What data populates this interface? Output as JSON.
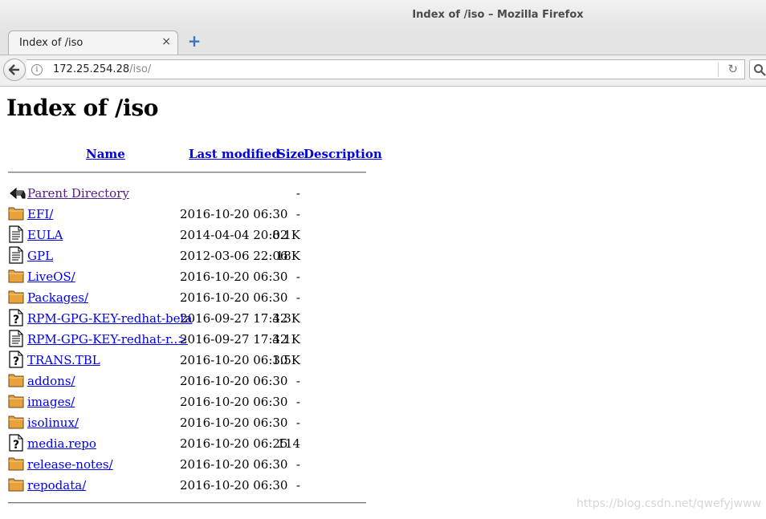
{
  "window": {
    "title": "Index of /iso – Mozilla Firefox"
  },
  "tab": {
    "title": "Index of /iso",
    "close_glyph": "×",
    "new_tab_glyph": "+"
  },
  "nav": {
    "url_host": "172.25.254.28",
    "url_path": "/iso/"
  },
  "page": {
    "heading": "Index of /iso",
    "columns": {
      "name": "Name",
      "last_modified": "Last modified",
      "size": "Size",
      "description": "Description"
    },
    "rows": [
      {
        "icon": "back-icon",
        "name": "Parent Directory",
        "modified": "",
        "size": "-",
        "visited": true
      },
      {
        "icon": "folder-icon",
        "name": "EFI/",
        "modified": "2016-10-20 06:30",
        "size": "-"
      },
      {
        "icon": "text-file-icon",
        "name": "EULA",
        "modified": "2014-04-04 20:02",
        "size": "8.1K"
      },
      {
        "icon": "text-file-icon",
        "name": "GPL",
        "modified": "2012-03-06 22:06",
        "size": "18K"
      },
      {
        "icon": "folder-icon",
        "name": "LiveOS/",
        "modified": "2016-10-20 06:30",
        "size": "-"
      },
      {
        "icon": "folder-icon",
        "name": "Packages/",
        "modified": "2016-10-20 06:30",
        "size": "-"
      },
      {
        "icon": "unknown-file-icon",
        "name": "RPM-GPG-KEY-redhat-beta",
        "modified": "2016-09-27 17:42",
        "size": "3.3K"
      },
      {
        "icon": "text-file-icon",
        "name": "RPM-GPG-KEY-redhat-r..>",
        "modified": "2016-09-27 17:42",
        "size": "3.1K"
      },
      {
        "icon": "unknown-file-icon",
        "name": "TRANS.TBL",
        "modified": "2016-10-20 06:30",
        "size": "1.5K"
      },
      {
        "icon": "folder-icon",
        "name": "addons/",
        "modified": "2016-10-20 06:30",
        "size": "-"
      },
      {
        "icon": "folder-icon",
        "name": "images/",
        "modified": "2016-10-20 06:30",
        "size": "-"
      },
      {
        "icon": "folder-icon",
        "name": "isolinux/",
        "modified": "2016-10-20 06:30",
        "size": "-"
      },
      {
        "icon": "unknown-file-icon",
        "name": "media.repo",
        "modified": "2016-10-20 06:25",
        "size": "114"
      },
      {
        "icon": "folder-icon",
        "name": "release-notes/",
        "modified": "2016-10-20 06:30",
        "size": "-"
      },
      {
        "icon": "folder-icon",
        "name": "repodata/",
        "modified": "2016-10-20 06:30",
        "size": "-"
      }
    ]
  },
  "watermark": "https://blog.csdn.net/qwefyjwww",
  "colors": {
    "link": "#0000ee",
    "visited_link": "#551a8b",
    "folder": "#e8a23c"
  }
}
